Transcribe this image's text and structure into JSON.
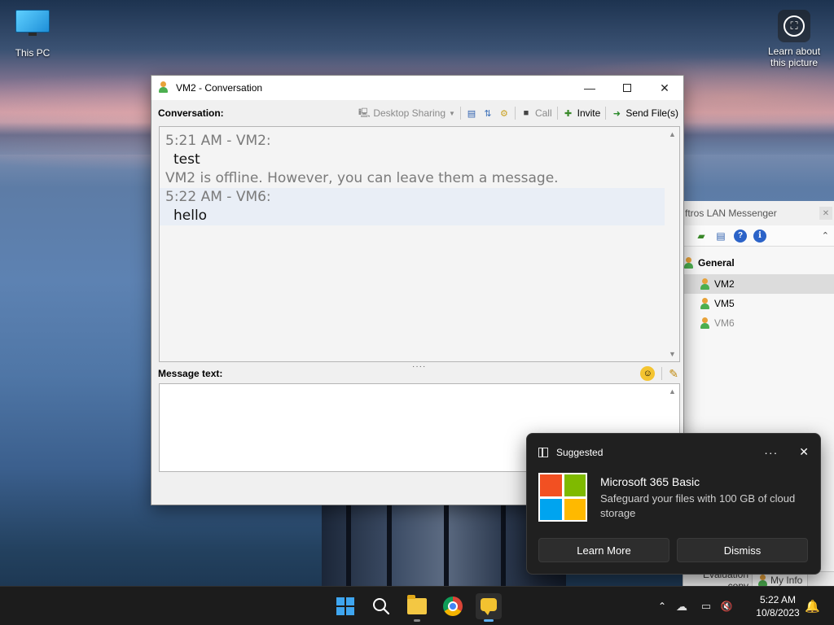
{
  "desktop": {
    "icons": [
      {
        "label": "This PC"
      },
      {
        "label": "Learn about this picture"
      }
    ]
  },
  "conversation_window": {
    "title": "VM2 - Conversation",
    "conversation_label": "Conversation:",
    "toolbar": {
      "desktop_sharing": "Desktop Sharing",
      "call": "Call",
      "invite": "Invite",
      "send_files": "Send File(s)"
    },
    "messages": [
      {
        "meta": "5:21 AM - VM2:",
        "text": "test"
      },
      {
        "info": "VM2 is offline. However, you can leave them a message."
      },
      {
        "meta": "5:22 AM - VM6:",
        "text": "hello"
      }
    ],
    "message_text_label": "Message text:",
    "message_value": ""
  },
  "lan_messenger": {
    "title_partial": "ftros LAN Messenger",
    "group": "General",
    "users": [
      {
        "name": "VM2",
        "status": "selected"
      },
      {
        "name": "VM5",
        "status": "online"
      },
      {
        "name": "VM6",
        "status": "offline"
      }
    ],
    "status_bar": {
      "eval": "Evaluation copy",
      "my_info": "My Info"
    }
  },
  "notification": {
    "header": "Suggested",
    "more": "···",
    "title": "Microsoft 365 Basic",
    "text": "Safeguard your files with 100 GB of cloud storage",
    "learn_more": "Learn More",
    "dismiss": "Dismiss"
  },
  "taskbar": {
    "time": "5:22 AM",
    "date": "10/8/2023"
  },
  "colors": {
    "taskbar_bg": "#1c1c1c",
    "toast_bg": "#202020",
    "selected_user_bg": "#dcdcdc",
    "accent": "#5fb2f2"
  }
}
